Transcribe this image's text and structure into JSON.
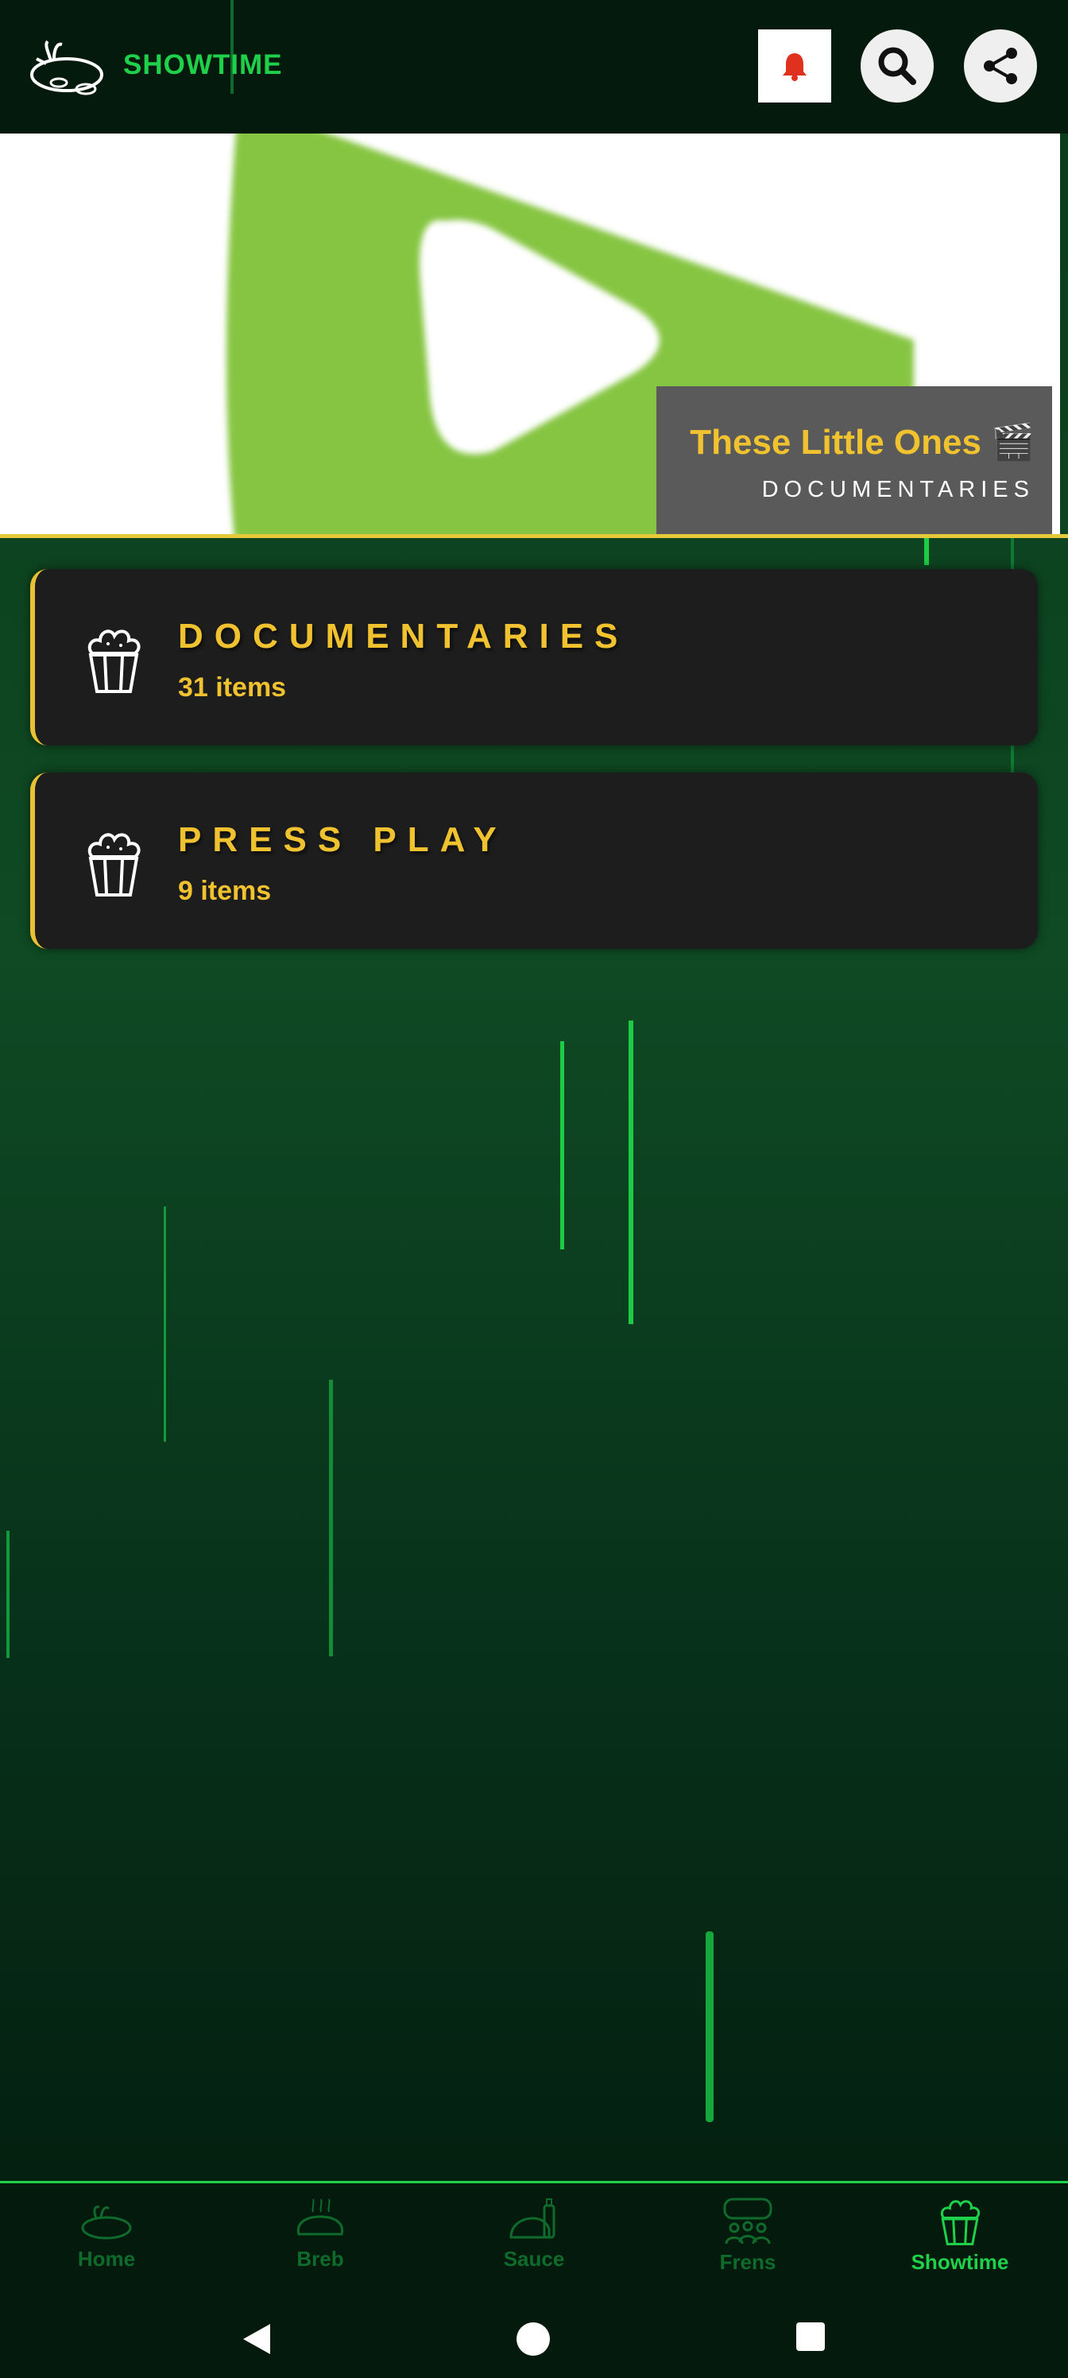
{
  "header": {
    "brand": "SHOWTIME",
    "icons": {
      "logo": "rat-logo-icon",
      "bell": "bell-icon",
      "search": "search-icon",
      "share": "share-icon"
    },
    "bell_color": "#e0301e",
    "brand_color": "#1fd14a"
  },
  "hero": {
    "title": "These Little Ones 🎬",
    "subtitle": "DOCUMENTARIES",
    "play_color": "#86c543"
  },
  "categories": [
    {
      "title": "DOCUMENTARIES",
      "count": "31 items",
      "icon": "popcorn-icon"
    },
    {
      "title": "PRESS PLAY",
      "count": "9 items",
      "icon": "popcorn-icon"
    }
  ],
  "bottom_nav": [
    {
      "label": "Home",
      "icon": "home-icon",
      "active": false
    },
    {
      "label": "Breb",
      "icon": "bread-icon",
      "active": false
    },
    {
      "label": "Sauce",
      "icon": "sauce-icon",
      "active": false
    },
    {
      "label": "Frens",
      "icon": "frens-icon",
      "active": false
    },
    {
      "label": "Showtime",
      "icon": "popcorn-icon",
      "active": true
    }
  ],
  "system_nav": {
    "back": "back-icon",
    "home": "home-circle-icon",
    "recents": "recents-icon"
  }
}
